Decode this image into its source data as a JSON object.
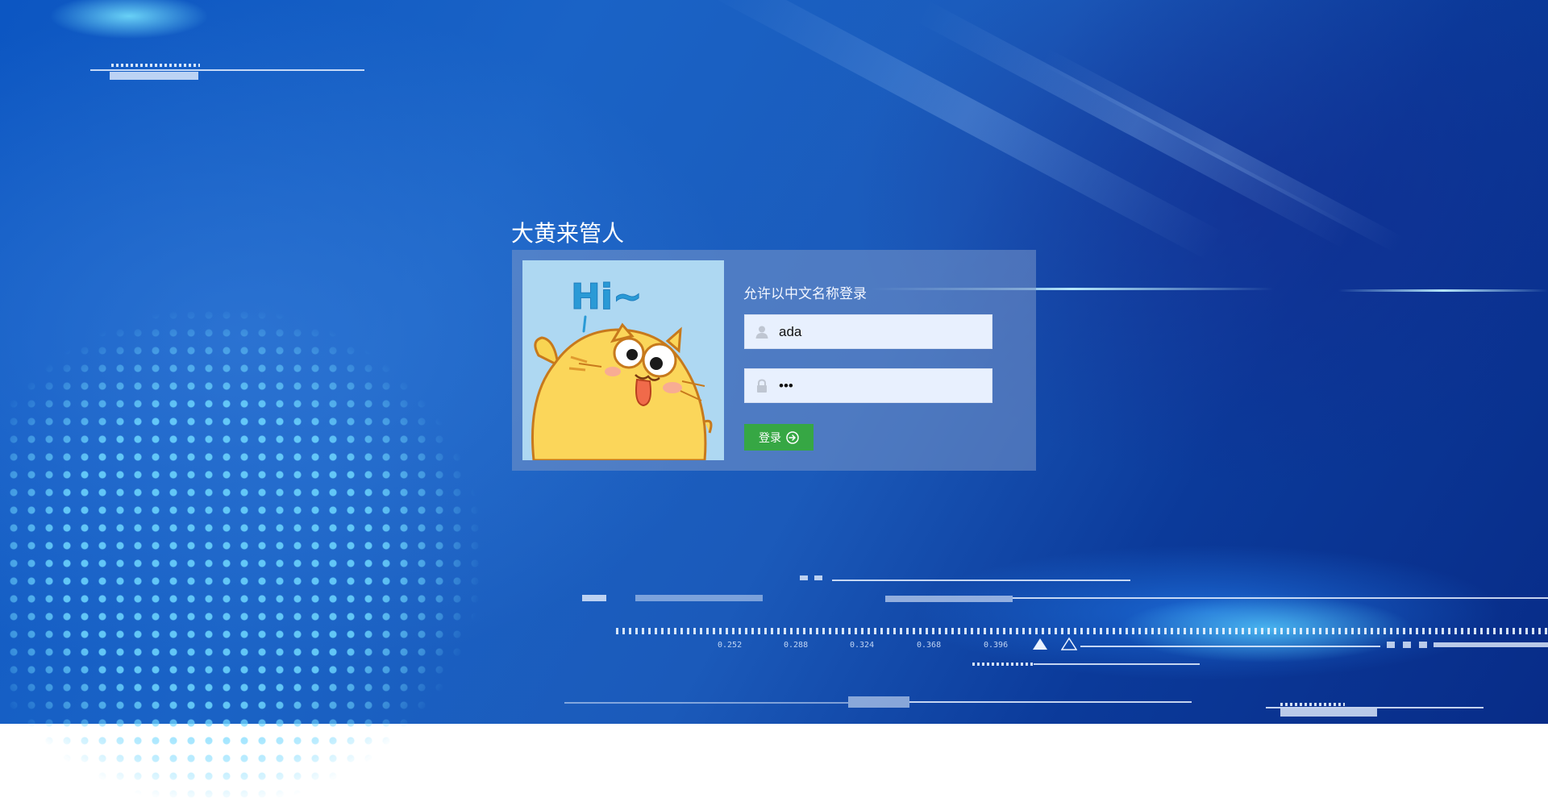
{
  "app": {
    "title": "大黄来管人"
  },
  "login": {
    "hint": "允许以中文名称登录",
    "username": {
      "value": "ada",
      "icon": "user-icon"
    },
    "password": {
      "value": "abc",
      "icon": "lock-icon"
    },
    "submit": {
      "label": "登录",
      "icon": "arrow-right-circle-icon",
      "color": "#36a744"
    },
    "mascot": {
      "caption": "Hi~"
    }
  },
  "hud": {
    "readouts": [
      "0.252",
      "0.288",
      "0.324",
      "0.368",
      "0.396"
    ]
  },
  "colors": {
    "background": "#1a5fc4",
    "panel": "#7896c8",
    "field": "#e8f0fe"
  }
}
